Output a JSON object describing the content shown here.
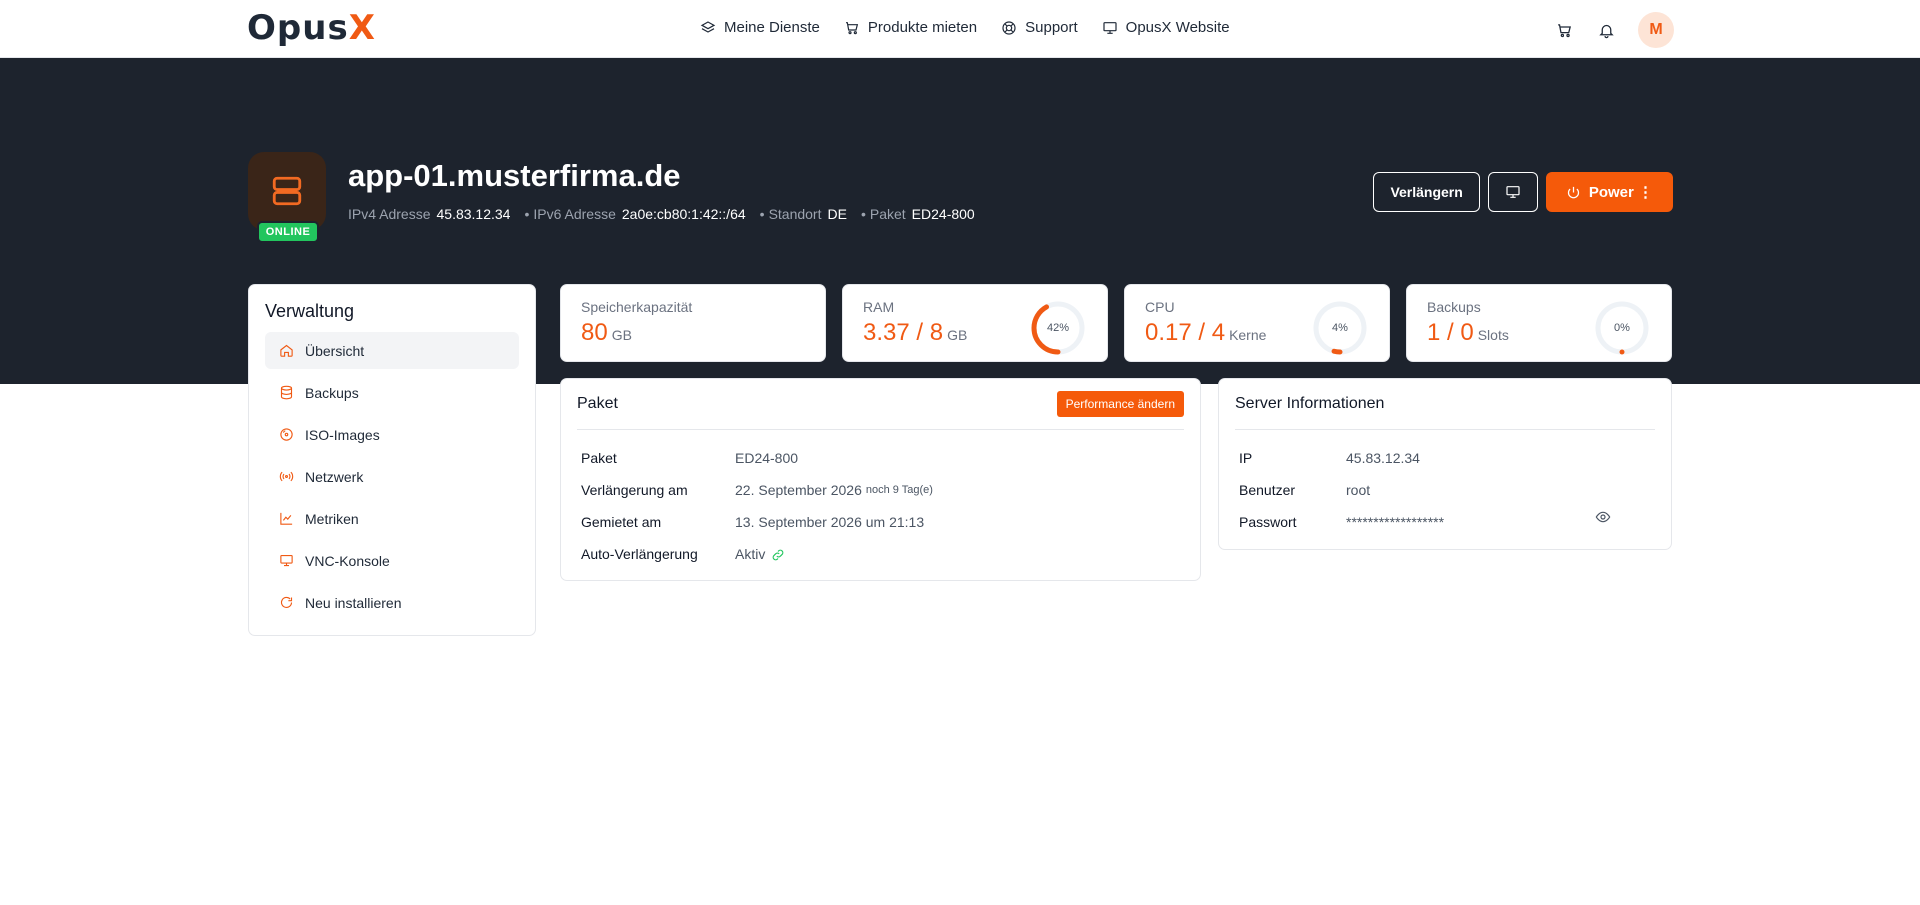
{
  "brand": {
    "logo_main": "Opus",
    "logo_accent": "X"
  },
  "nav": [
    {
      "label": "Meine Dienste",
      "icon": "layers-icon"
    },
    {
      "label": "Produkte mieten",
      "icon": "cart-icon"
    },
    {
      "label": "Support",
      "icon": "lifebuoy-icon"
    },
    {
      "label": "OpusX Website",
      "icon": "monitor-icon"
    }
  ],
  "user": {
    "initial": "M"
  },
  "server": {
    "hostname": "app-01.musterfirma.de",
    "status": "ONLINE",
    "ipv4_label": "IPv4 Adresse",
    "ipv4": "45.83.12.34",
    "ipv6_label": "IPv6 Adresse",
    "ipv6": "2a0e:cb80:1:42::/64",
    "location_label": "Standort",
    "location": "DE",
    "package_label": "Paket",
    "package": "ED24-800"
  },
  "actions": {
    "renew": "Verlängern",
    "power": "Power ⋮"
  },
  "sidebar": {
    "title": "Verwaltung",
    "items": [
      {
        "label": "Übersicht",
        "icon": "home-icon"
      },
      {
        "label": "Backups",
        "icon": "database-icon"
      },
      {
        "label": "ISO-Images",
        "icon": "disc-icon"
      },
      {
        "label": "Netzwerk",
        "icon": "signal-icon"
      },
      {
        "label": "Metriken",
        "icon": "chart-icon"
      },
      {
        "label": "VNC-Konsole",
        "icon": "monitor-icon"
      },
      {
        "label": "Neu installieren",
        "icon": "refresh-icon"
      }
    ]
  },
  "stats": {
    "storage": {
      "label": "Speicherkapazität",
      "value": "80",
      "unit": "GB"
    },
    "ram": {
      "label": "RAM",
      "value": "3.37 / 8",
      "unit": "GB",
      "percent": 42,
      "percent_label": "42%"
    },
    "cpu": {
      "label": "CPU",
      "value": "0.17 / 4",
      "unit": "Kerne",
      "percent": 4,
      "percent_label": "4%"
    },
    "backups": {
      "label": "Backups",
      "value": "1 / 0",
      "unit": "Slots",
      "percent": 0,
      "percent_label": "0%"
    }
  },
  "paket": {
    "title": "Paket",
    "button": "Performance ändern",
    "rows": [
      {
        "k": "Paket",
        "v": "ED24-800"
      },
      {
        "k": "Verlängerung am",
        "v": "22. September 2026",
        "note": "noch 9 Tag(e)"
      },
      {
        "k": "Gemietet am",
        "v": "13. September 2026 um 21:13"
      },
      {
        "k": "Auto-Verlängerung",
        "v": "Aktiv"
      }
    ]
  },
  "info": {
    "title": "Server Informationen",
    "rows": [
      {
        "k": "IP",
        "v": "45.83.12.34"
      },
      {
        "k": "Benutzer",
        "v": "root"
      },
      {
        "k": "Passwort",
        "v": "******************"
      }
    ]
  },
  "colors": {
    "accent": "#f05a14",
    "hero_bg": "#1d232d",
    "online": "#22c55e"
  }
}
